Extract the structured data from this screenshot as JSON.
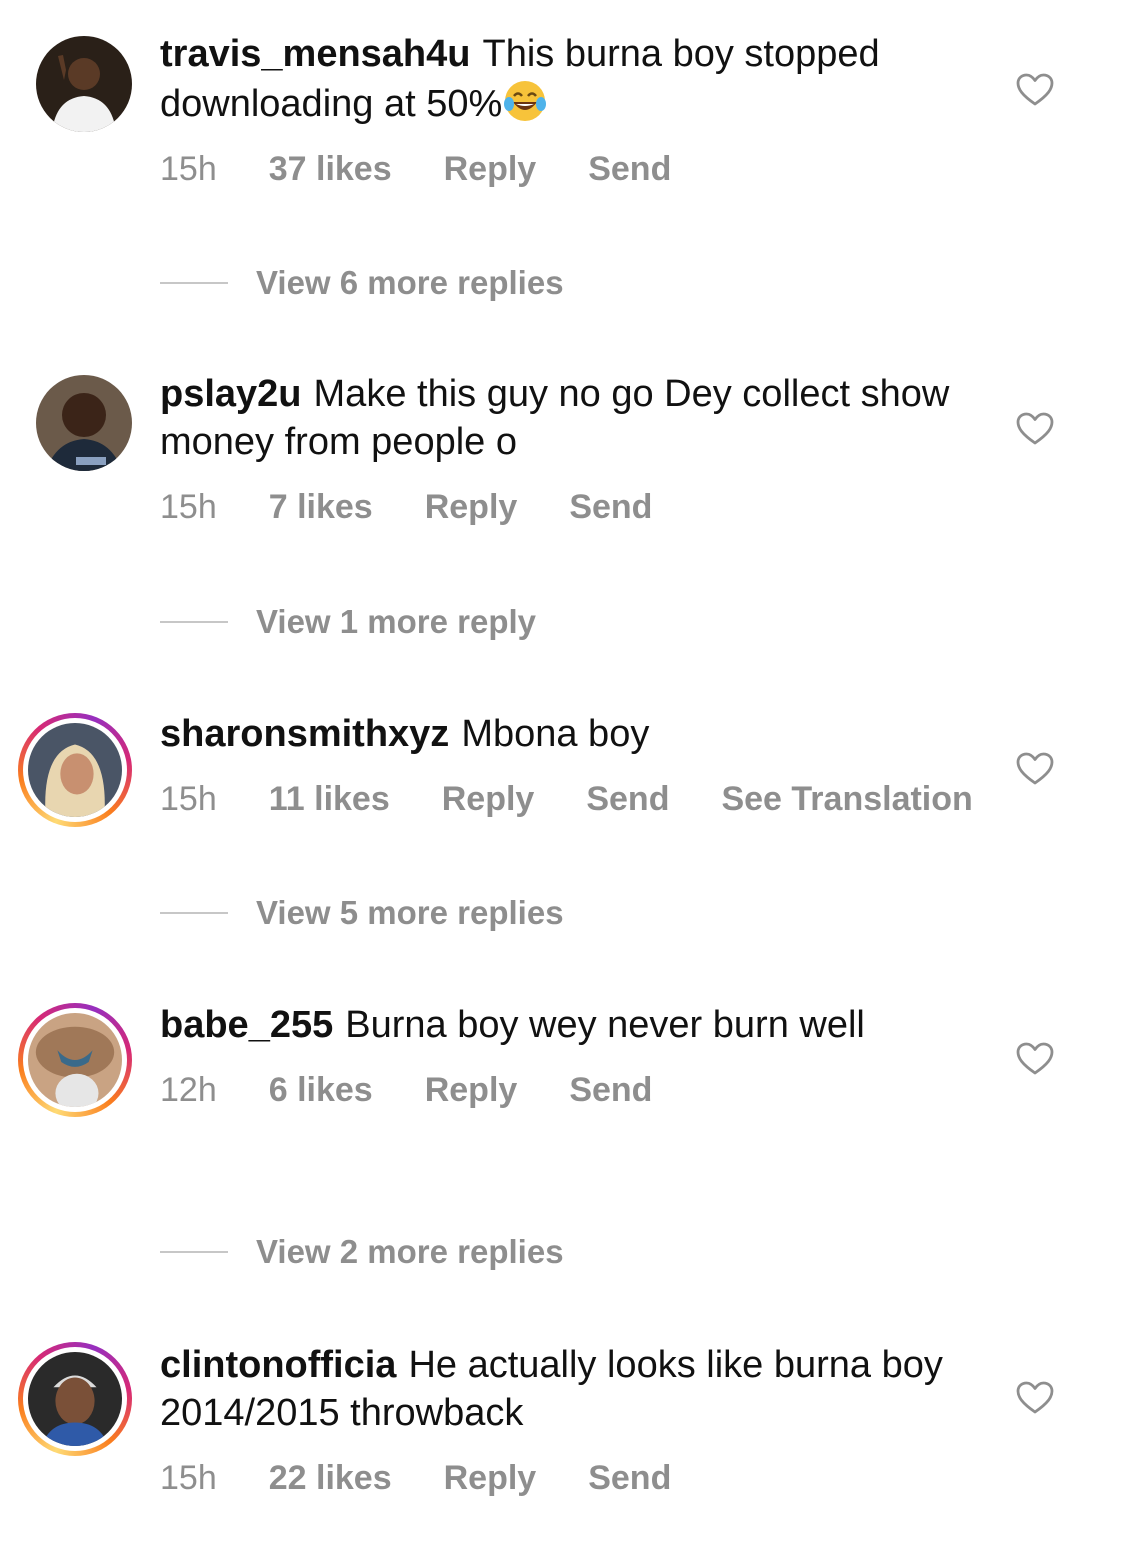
{
  "comments": [
    {
      "username": "travis_mensah4u",
      "text": "This burna boy stopped downloading at 50%",
      "emoji": "😂",
      "time": "15h",
      "likes": "37 likes",
      "reply": "Reply",
      "send": "Send",
      "view_replies": "View 6 more replies",
      "has_story": false
    },
    {
      "username": "pslay2u",
      "text": "Make this guy no go Dey collect show money from people o",
      "time": "15h",
      "likes": "7 likes",
      "reply": "Reply",
      "send": "Send",
      "view_replies": "View 1 more reply",
      "has_story": false
    },
    {
      "username": "sharonsmithxyz",
      "text": "Mbona boy",
      "time": "15h",
      "likes": "11 likes",
      "reply": "Reply",
      "send": "Send",
      "translate": "See Translation",
      "view_replies": "View 5 more replies",
      "has_story": true
    },
    {
      "username": "babe_255",
      "text": "Burna boy wey never burn well",
      "time": "12h",
      "likes": "6 likes",
      "reply": "Reply",
      "send": "Send",
      "view_replies": "View 2 more replies",
      "has_story": true
    },
    {
      "username": "clintonofficia",
      "text": "He actually looks like burna boy 2014/2015 throwback",
      "time": "15h",
      "likes": "22 likes",
      "reply": "Reply",
      "send": "Send",
      "has_story": true
    }
  ],
  "colors": {
    "meta_gray": "#8e8e8e",
    "divider": "#c7c7c7",
    "text": "#111111"
  }
}
